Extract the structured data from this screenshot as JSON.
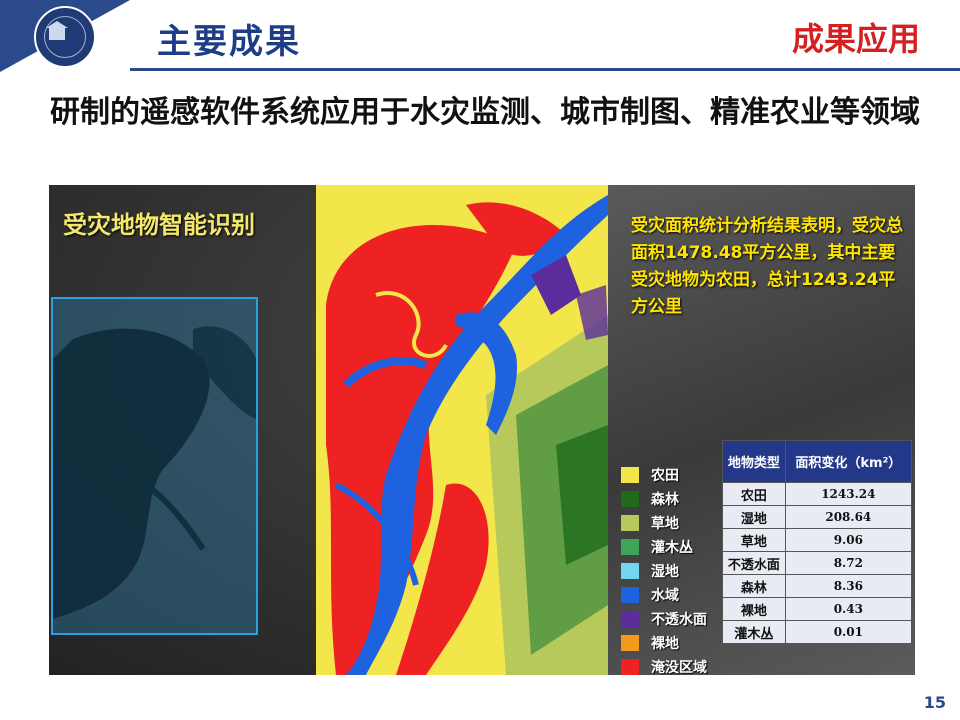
{
  "header": {
    "title": "主要成果",
    "section": "成果应用"
  },
  "subtitle": "研制的遥感软件系统应用于水灾监测、城市制图、精准农业等领域",
  "figure": {
    "panel_title": "受灾地物智能识别",
    "result_text": "受灾面积统计分析结果表明，受灾总面积1478.48平方公里，其中主要受灾地物为农田，总计1243.24平方公里",
    "legend": [
      {
        "label": "农田",
        "color": "#f2e64a"
      },
      {
        "label": "森林",
        "color": "#1f6b1a"
      },
      {
        "label": "草地",
        "color": "#b7c95a"
      },
      {
        "label": "灌木丛",
        "color": "#3fa35a"
      },
      {
        "label": "湿地",
        "color": "#72d6ee"
      },
      {
        "label": "水域",
        "color": "#1f62e0"
      },
      {
        "label": "不透水面",
        "color": "#5a2c9c"
      },
      {
        "label": "裸地",
        "color": "#f39a1d"
      },
      {
        "label": "淹没区域",
        "color": "#ee2222"
      }
    ],
    "table": {
      "headers": [
        "地物类型",
        "面积变化（km²）"
      ],
      "rows": [
        [
          "农田",
          "1243.24"
        ],
        [
          "湿地",
          "208.64"
        ],
        [
          "草地",
          "9.06"
        ],
        [
          "不透水面",
          "8.72"
        ],
        [
          "森林",
          "8.36"
        ],
        [
          "裸地",
          "0.43"
        ],
        [
          "灌木丛",
          "0.01"
        ]
      ]
    }
  },
  "page_number": "15"
}
